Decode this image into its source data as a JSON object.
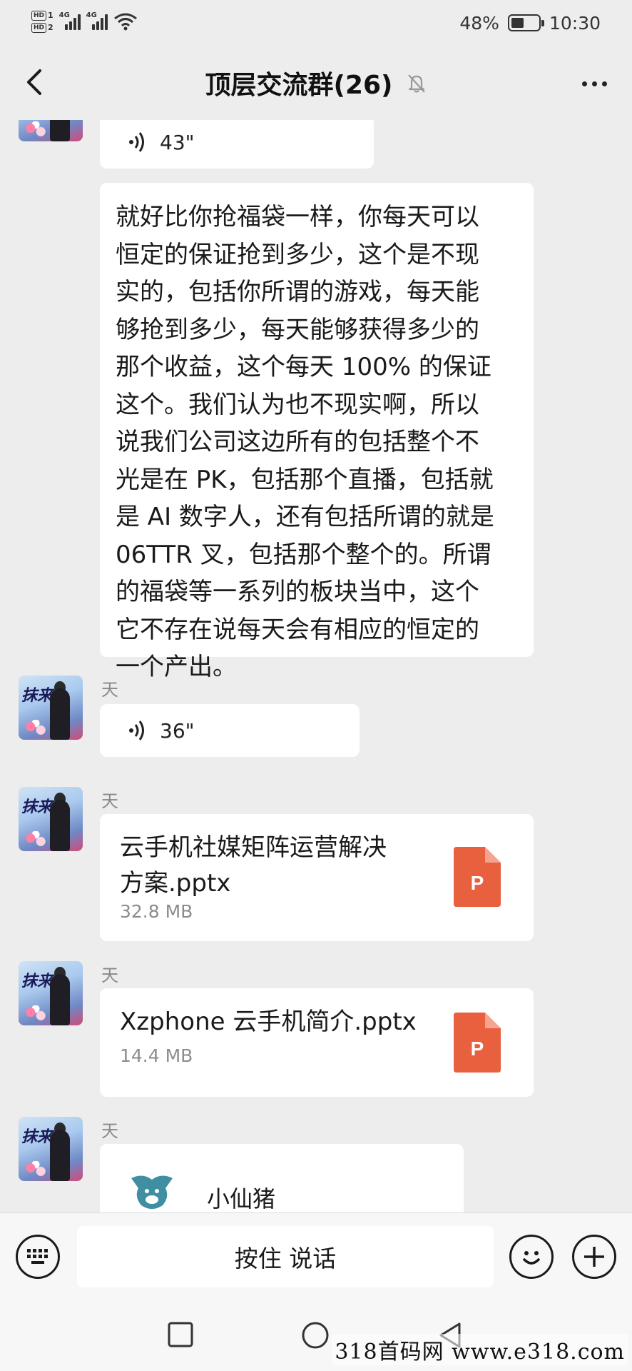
{
  "status_bar": {
    "hd1": "HD",
    "hd1_sub": "1",
    "hd2": "HD",
    "hd2_sub": "2",
    "net1": "4G",
    "net2": "4G",
    "battery_percent": "48%",
    "battery_level": 0.48,
    "time": "10:30",
    "icons": [
      "signal-icon",
      "wifi-icon",
      "battery-icon"
    ]
  },
  "header": {
    "back_icon": "back-chevron-icon",
    "title": "顶层交流群(26)",
    "mute_icon": "bell-muted-icon",
    "more_icon": "more-dots-icon"
  },
  "messages": [
    {
      "type": "voice",
      "duration": "43\""
    },
    {
      "type": "text",
      "text": "就好比你抢福袋一样，你每天可以\n恒定的保证抢到多少，这个是不现\n实的，包括你所谓的游戏，每天能\n够抢到多少，每天能够获得多少的\n那个收益，这个每天 100% 的保证\n这个。我们认为也不现实啊，所以\n说我们公司这边所有的包括整个不\n光是在 PK，包括那个直播，包括就\n是 AI 数字人，还有包括所谓的就是\n06TTR 叉，包括那个整个的。所谓\n的福袋等一系列的板块当中，这个\n它不存在说每天会有相应的恒定的\n一个产出。"
    },
    {
      "type": "voice",
      "sender": "天",
      "duration": "36\""
    },
    {
      "type": "file",
      "sender": "天",
      "name": "云手机社媒矩阵运营解决\n方案.pptx",
      "size": "32.8 MB",
      "file_icon_letter": "P"
    },
    {
      "type": "file",
      "sender": "天",
      "name": "Xzphone 云手机简介.pptx",
      "size": "14.4 MB",
      "file_icon_letter": "P"
    },
    {
      "type": "mini_program",
      "sender": "天",
      "name": "小仙猪"
    }
  ],
  "input_bar": {
    "keyboard_icon": "keyboard-icon",
    "talk_label": "按住 说话",
    "emoji_icon": "emoji-icon",
    "plus_icon": "plus-icon"
  },
  "system_nav": {
    "icons": [
      "square-recents-icon",
      "circle-home-icon",
      "triangle-back-icon"
    ],
    "watermark": "318首码网 www.e318.com"
  },
  "colors": {
    "background": "#ededed",
    "bubble": "#ffffff",
    "ppt_orange": "#e9603f",
    "muted_text": "#8a8a8a"
  }
}
